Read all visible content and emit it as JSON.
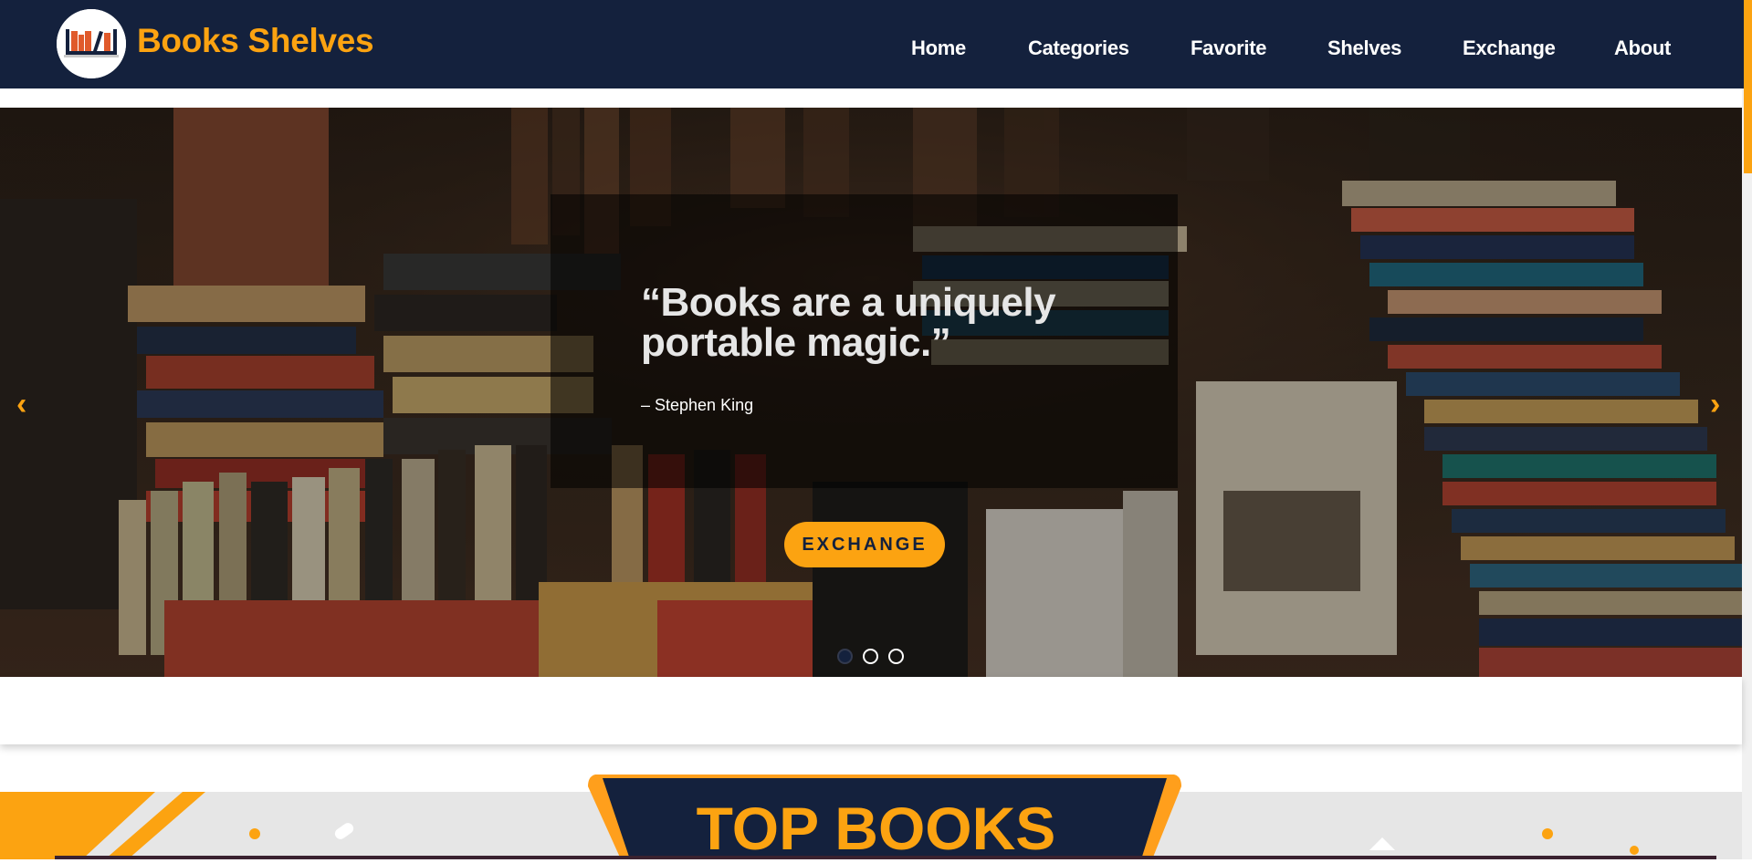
{
  "header": {
    "brand": "Books Shelves",
    "logo_icon": "bookshelf-logo-icon",
    "nav": [
      {
        "label": "Home"
      },
      {
        "label": "Categories"
      },
      {
        "label": "Favorite"
      },
      {
        "label": "Shelves"
      },
      {
        "label": "Exchange"
      },
      {
        "label": "About"
      }
    ]
  },
  "hero": {
    "quote": "“Books are a uniquely portable magic.”",
    "author": "– Stephen King",
    "button_label": "EXCHANGE",
    "prev_icon": "‹",
    "next_icon": "›",
    "slides_total": 3,
    "active_slide": 1
  },
  "section": {
    "title": "TOP BOOKS"
  },
  "colors": {
    "navy": "#14213d",
    "accent": "#fca311",
    "light_gray": "#e6e6e6"
  }
}
